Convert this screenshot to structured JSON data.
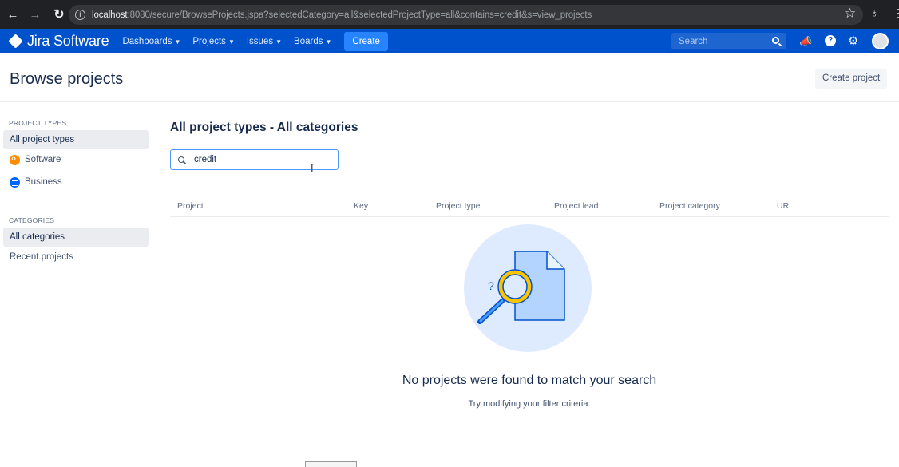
{
  "browser": {
    "url_host": "localhost",
    "url_rest": ":8080/secure/BrowseProjects.jspa?selectedCategory=all&selectedProjectType=all&contains=credit&s=view_projects"
  },
  "topnav": {
    "brand": "Jira Software",
    "items": [
      "Dashboards",
      "Projects",
      "Issues",
      "Boards"
    ],
    "create_label": "Create",
    "search_placeholder": "Search"
  },
  "page": {
    "title": "Browse projects",
    "create_project_label": "Create project"
  },
  "sidebar": {
    "project_types_heading": "PROJECT TYPES",
    "project_types": [
      "All project types",
      "Software",
      "Business"
    ],
    "categories_heading": "CATEGORIES",
    "categories": [
      "All categories",
      "Recent projects"
    ]
  },
  "main": {
    "section_title": "All project types - All categories",
    "filter_value": "credit",
    "columns": [
      "Project",
      "Key",
      "Project type",
      "Project lead",
      "Project category",
      "URL"
    ],
    "empty_title": "No projects were found to match your search",
    "empty_subtitle": "Try modifying your filter criteria."
  },
  "colors": {
    "nav_blue": "#0052cc",
    "create_blue": "#2684ff",
    "software_orange": "#ff8b00",
    "business_blue": "#0065ff"
  },
  "icons": [
    "back-icon",
    "forward-icon",
    "reload-icon",
    "info-icon",
    "star-icon",
    "extension-icon",
    "menu-icon",
    "jira-logo-icon",
    "search-icon",
    "notifications-icon",
    "help-icon",
    "settings-icon",
    "avatar",
    "software-icon",
    "business-icon",
    "filter-search-icon",
    "empty-search-illustration"
  ]
}
